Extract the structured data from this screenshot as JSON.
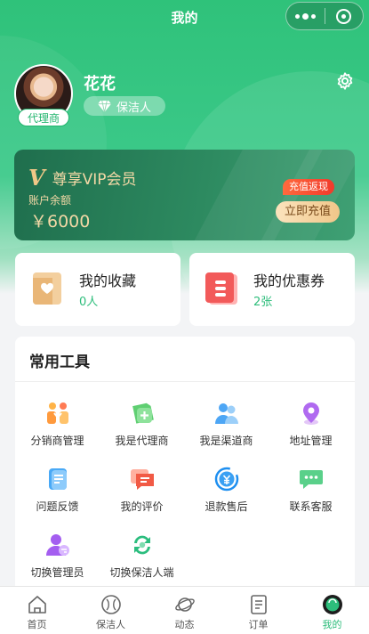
{
  "nav": {
    "title": "我的"
  },
  "profile": {
    "name": "花花",
    "avatar_role": "代理商",
    "badge_label": "保洁人"
  },
  "vip": {
    "title": "尊享VIP会员",
    "balance_label": "账户余额",
    "balance": "￥6000",
    "promo": "充值返现",
    "button": "立即充值"
  },
  "cards": [
    {
      "title": "我的收藏",
      "sub": "0人",
      "icon": "bookmark-heart-icon"
    },
    {
      "title": "我的优惠券",
      "sub": "2张",
      "icon": "coupon-icon"
    }
  ],
  "tools": {
    "title": "常用工具",
    "items": [
      {
        "label": "分销商管理",
        "icon": "distributor-icon"
      },
      {
        "label": "我是代理商",
        "icon": "agent-icon"
      },
      {
        "label": "我是渠道商",
        "icon": "channel-icon"
      },
      {
        "label": "地址管理",
        "icon": "location-pin-icon"
      },
      {
        "label": "问题反馈",
        "icon": "feedback-icon"
      },
      {
        "label": "我的评价",
        "icon": "review-icon"
      },
      {
        "label": "退款售后",
        "icon": "refund-icon"
      },
      {
        "label": "联系客服",
        "icon": "chat-icon"
      },
      {
        "label": "切换管理员",
        "icon": "switch-admin-icon"
      },
      {
        "label": "切换保洁人端",
        "icon": "switch-cleaner-icon"
      }
    ]
  },
  "tabbar": [
    {
      "label": "首页",
      "icon": "home-icon"
    },
    {
      "label": "保洁人",
      "icon": "cleaner-icon"
    },
    {
      "label": "动态",
      "icon": "planet-icon"
    },
    {
      "label": "订单",
      "icon": "order-icon"
    },
    {
      "label": "我的",
      "icon": "profile-icon",
      "active": true
    }
  ],
  "colors": {
    "primary": "#2dbd7b",
    "vip_gold": "#f3d8a6",
    "promo_red": "#f13a2b"
  }
}
